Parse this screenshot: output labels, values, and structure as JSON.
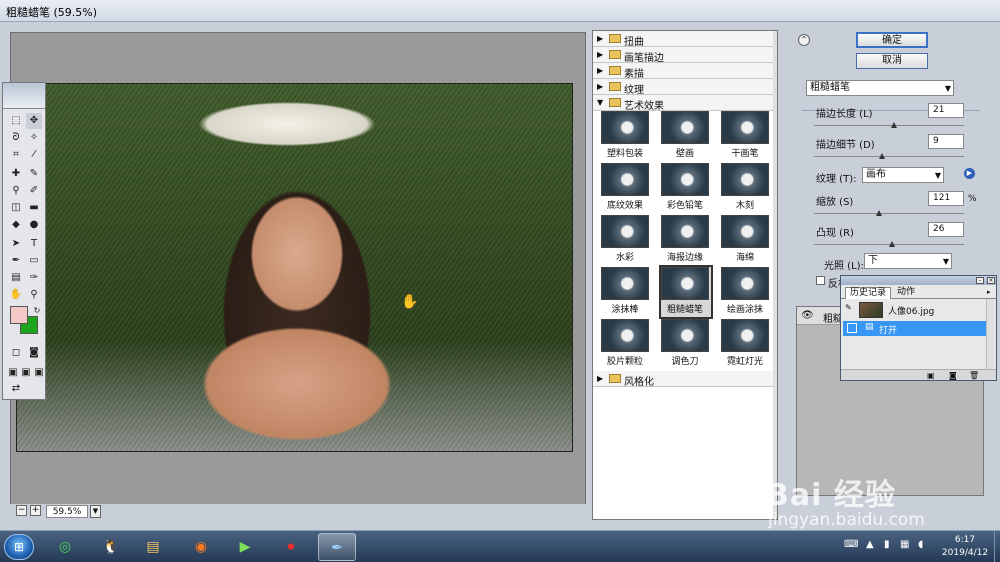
{
  "window": {
    "title": "粗糙蜡笔 (59.5%)"
  },
  "preview": {
    "zoom": "59.5%"
  },
  "filter_gallery": {
    "categories_top": [
      "扭曲",
      "画笔描边",
      "素描",
      "纹理"
    ],
    "expanded_category": "艺术效果",
    "filters": [
      "塑料包装",
      "壁画",
      "干画笔",
      "底纹效果",
      "彩色铅笔",
      "木刻",
      "水彩",
      "海报边缘",
      "海绵",
      "涂抹棒",
      "粗糙蜡笔",
      "绘画涂抹",
      "胶片颗粒",
      "调色刀",
      "霓虹灯光"
    ],
    "selected_filter": "粗糙蜡笔",
    "categories_bottom": [
      "风格化"
    ]
  },
  "settings": {
    "ok_label": "确定",
    "cancel_label": "取消",
    "filter_select": "粗糙蜡笔",
    "stroke_length_label": "描边长度 (L)",
    "stroke_length_value": "21",
    "stroke_detail_label": "描边细节 (D)",
    "stroke_detail_value": "9",
    "texture_label": "纹理 (T):",
    "texture_value": "画布",
    "scaling_label": "缩放 (S)",
    "scaling_value": "121",
    "scaling_unit": "%",
    "relief_label": "凸现 (R)",
    "relief_value": "26",
    "light_label": "光照 (L):",
    "light_value": "下",
    "invert_label": "反相",
    "layer_name": "粗糙蜡笔"
  },
  "sliders": {
    "stroke_length": 0.53,
    "stroke_detail": 0.45,
    "scaling": 0.43,
    "relief": 0.52
  },
  "history": {
    "tab_history": "历史记录",
    "tab_actions": "动作",
    "snapshot_name": "人像06.jpg",
    "item_open": "打开"
  },
  "taskbar": {
    "time": "6:17",
    "date": "2019/4/12"
  },
  "watermark": {
    "brand": "Bai 经验",
    "url": "jingyan.baidu.com"
  }
}
